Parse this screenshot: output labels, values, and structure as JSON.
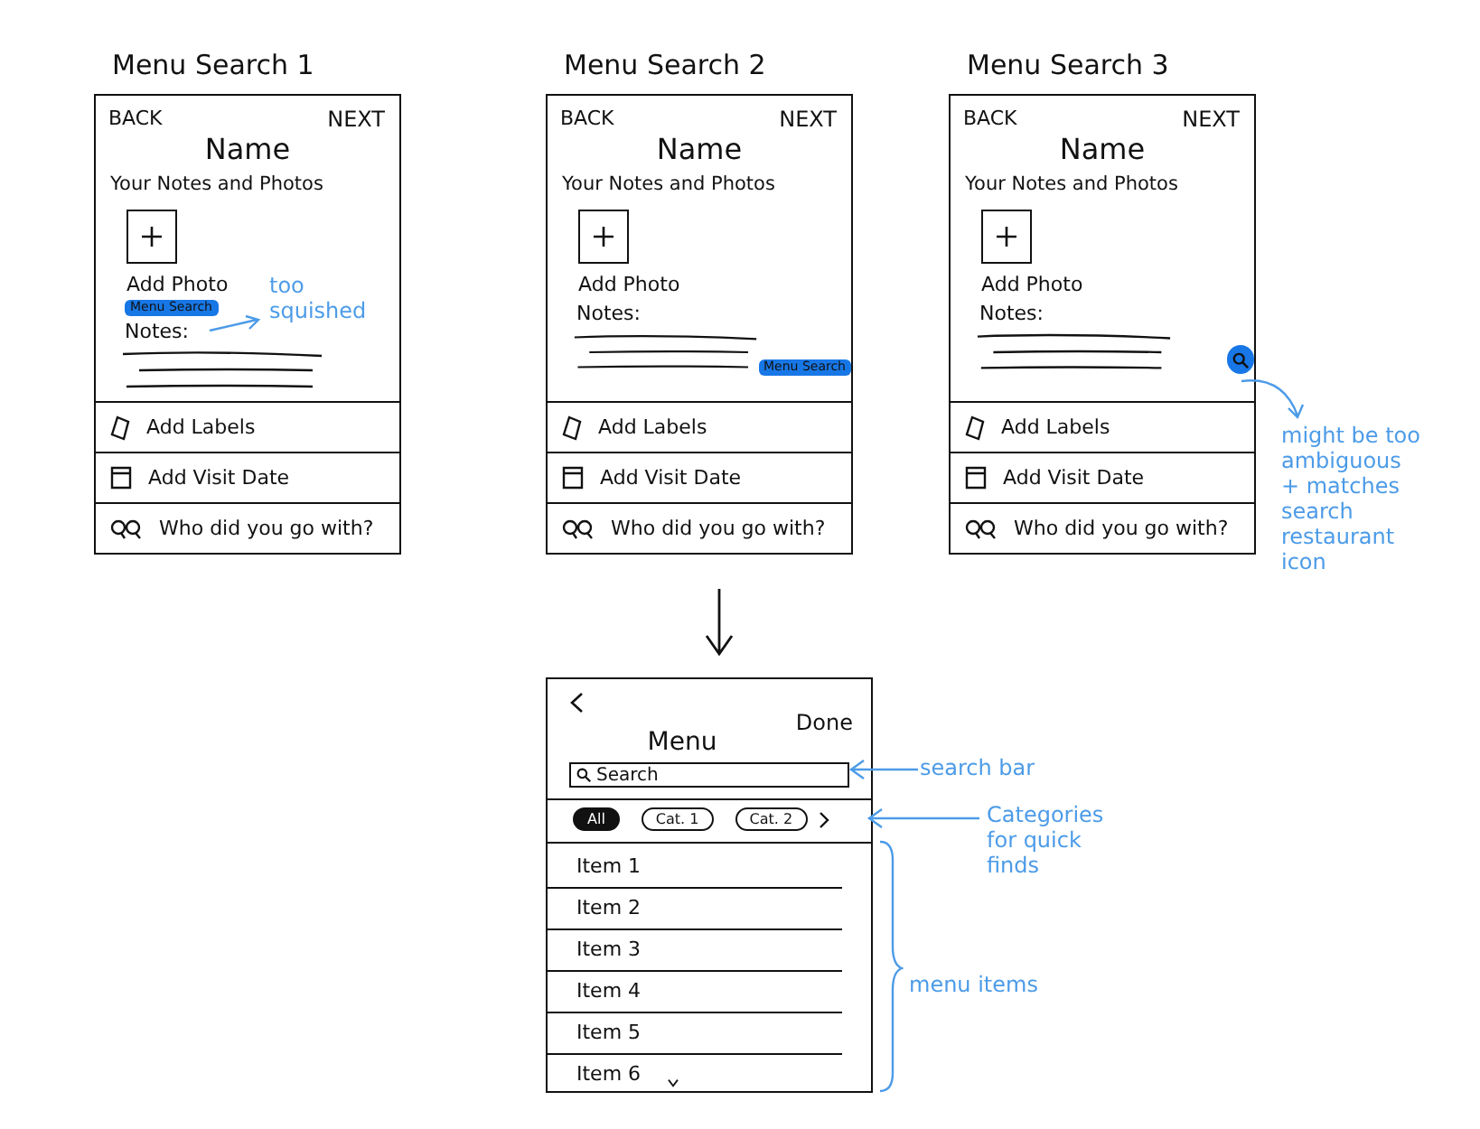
{
  "frames": [
    {
      "title": "Menu Search 1",
      "back": "BACK",
      "next": "NEXT",
      "name": "Name",
      "section": "Your Notes and Photos",
      "add_photo": "Add Photo",
      "notes_label": "Notes:",
      "menu_search": {
        "kind": "below_photo",
        "label": "Menu Search"
      },
      "rows": [
        {
          "kind": "labels",
          "label": "Add Labels"
        },
        {
          "kind": "date",
          "label": "Add Visit Date"
        },
        {
          "kind": "companions",
          "label": "Who did you go with?"
        }
      ],
      "note": "too squished"
    },
    {
      "title": "Menu Search 2",
      "back": "BACK",
      "next": "NEXT",
      "name": "Name",
      "section": "Your Notes and Photos",
      "add_photo": "Add Photo",
      "notes_label": "Notes:",
      "menu_search": {
        "kind": "notes_end",
        "label": "Menu Search"
      },
      "rows": [
        {
          "kind": "labels",
          "label": "Add Labels"
        },
        {
          "kind": "date",
          "label": "Add Visit Date"
        },
        {
          "kind": "companions",
          "label": "Who did you go with?"
        }
      ]
    },
    {
      "title": "Menu Search 3",
      "back": "BACK",
      "next": "NEXT",
      "name": "Name",
      "section": "Your Notes and Photos",
      "add_photo": "Add Photo",
      "notes_label": "Notes:",
      "menu_search": {
        "kind": "icon_button"
      },
      "rows": [
        {
          "kind": "labels",
          "label": "Add Labels"
        },
        {
          "kind": "date",
          "label": "Add Visit Date"
        },
        {
          "kind": "companions",
          "label": "Who did you go with?"
        }
      ],
      "note": "might be too ambiguous + matches search restaurant icon"
    }
  ],
  "menu_screen": {
    "done": "Done",
    "title": "Menu",
    "search": {
      "placeholder": "Search",
      "note": "search bar"
    },
    "categories": [
      {
        "label": "All",
        "selected": true
      },
      {
        "label": "Cat. 1",
        "selected": false
      },
      {
        "label": "Cat. 2",
        "selected": false
      }
    ],
    "categories_note": "Categories for quick finds",
    "items": [
      "Item 1",
      "Item 2",
      "Item 3",
      "Item 4",
      "Item 5",
      "Item 6"
    ],
    "items_note": "menu items"
  }
}
